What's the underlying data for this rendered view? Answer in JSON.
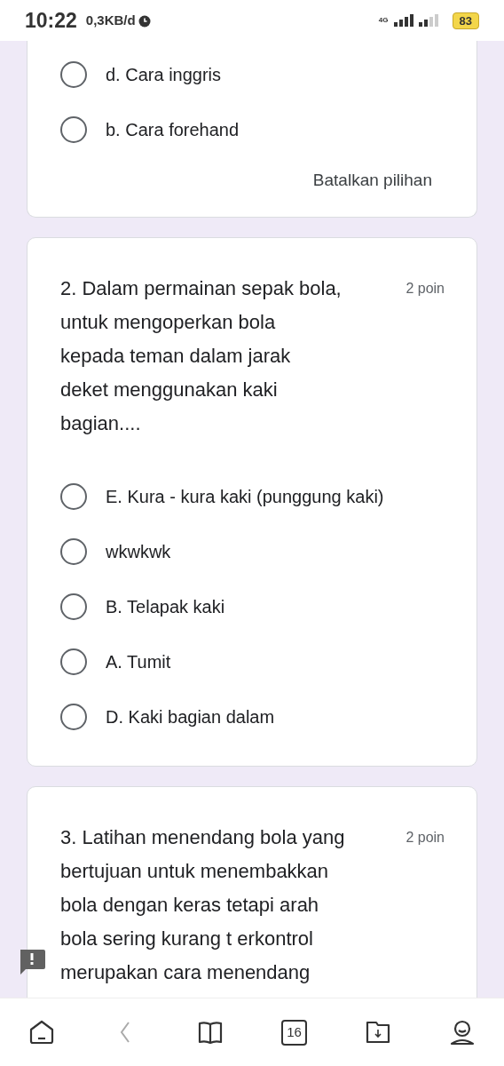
{
  "status_bar": {
    "time": "10:22",
    "data_rate": "0,3KB/d",
    "network": "4G",
    "battery": "83"
  },
  "questions": [
    {
      "options": [
        {
          "label": "d. Cara inggris",
          "selected": false
        },
        {
          "label": "b. Cara forehand",
          "selected": false
        }
      ],
      "clear_button": "Batalkan pilihan"
    },
    {
      "text": "2. Dalam permainan sepak bola,\nuntuk mengoperkan bola\nkepada teman dalam jarak\ndeket menggunakan kaki\nbagian....",
      "points": "2 poin",
      "options": [
        {
          "label": "E. Kura - kura kaki (punggung kaki)",
          "selected": false
        },
        {
          "label": "wkwkwk",
          "selected": false
        },
        {
          "label": "B. Telapak kaki",
          "selected": false
        },
        {
          "label": "A. Tumit",
          "selected": false
        },
        {
          "label": "D. Kaki bagian dalam",
          "selected": false
        }
      ]
    },
    {
      "text": "3. Latihan menendang bola yang\nbertujuan untuk menembakkan\nbola dengan keras tetapi arah\nbola sering kurang t erkontrol\nmerupakan cara menendang",
      "points": "2 poin"
    }
  ],
  "nav_badge": "16"
}
